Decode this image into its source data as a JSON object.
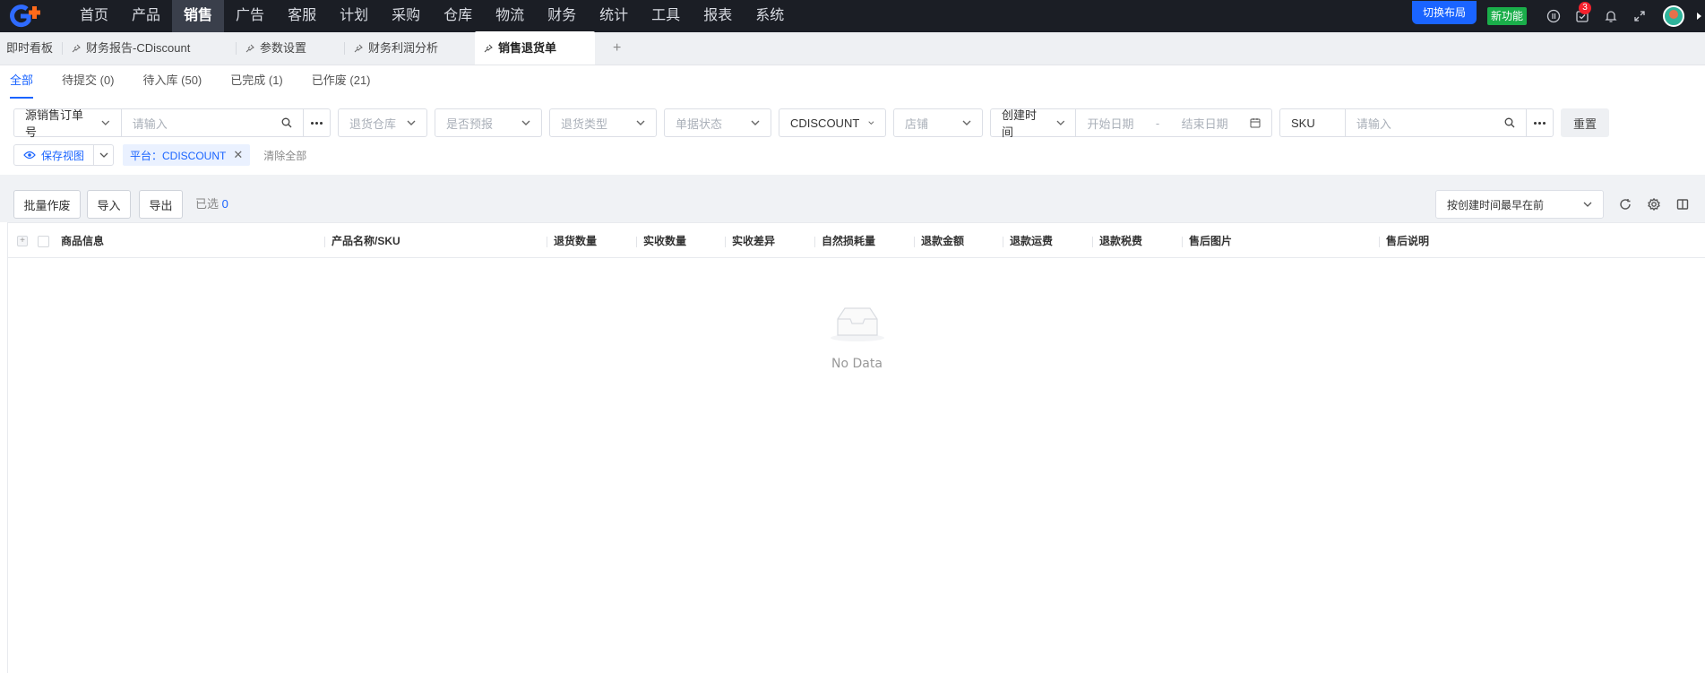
{
  "nav": {
    "items": [
      "首页",
      "产品",
      "销售",
      "广告",
      "客服",
      "计划",
      "采购",
      "仓库",
      "物流",
      "财务",
      "统计",
      "工具",
      "报表",
      "系统"
    ],
    "active_index": 2,
    "switch_layout": "切换布局",
    "new_feature": "新功能",
    "task_badge": "3"
  },
  "page_tabs": {
    "dashboard": "即时看板",
    "tabs": [
      "财务报告-CDiscount",
      "参数设置",
      "财务利润分析",
      "销售退货单"
    ],
    "active_index": 3,
    "add": "+"
  },
  "status_tabs": [
    "全部",
    "待提交 (0)",
    "待入库 (50)",
    "已完成 (1)",
    "已作废 (21)"
  ],
  "filters": {
    "order_type": "源销售订单号",
    "order_placeholder": "请输入",
    "warehouse_placeholder": "退货仓库",
    "forecast_placeholder": "是否预报",
    "return_type_placeholder": "退货类型",
    "doc_status_placeholder": "单据状态",
    "platform": "CDISCOUNT",
    "store_placeholder": "店铺",
    "date_type": "创建时间",
    "start_date_placeholder": "开始日期",
    "date_sep": "-",
    "end_date_placeholder": "结束日期",
    "sku_label": "SKU",
    "sku_placeholder": "请输入",
    "reset": "重置",
    "save_view": "保存视图",
    "tag_platform": "平台：CDISCOUNT",
    "clear_all": "清除全部"
  },
  "actions": {
    "batch_void": "批量作废",
    "import": "导入",
    "export": "导出",
    "selected_label": "已选",
    "selected_count": "0",
    "sort": "按创建时间最早在前"
  },
  "table": {
    "columns": [
      "商品信息",
      "产品名称/SKU",
      "退货数量",
      "实收数量",
      "实收差异",
      "自然损耗量",
      "退款金额",
      "退款运费",
      "退款税费",
      "售后图片",
      "售后说明"
    ],
    "empty_text": "No Data"
  },
  "colors": {
    "primary": "#1a64ff",
    "nav_bg": "#1b1e25",
    "new_badge": "#1aae4a",
    "alert": "#f5222d"
  }
}
